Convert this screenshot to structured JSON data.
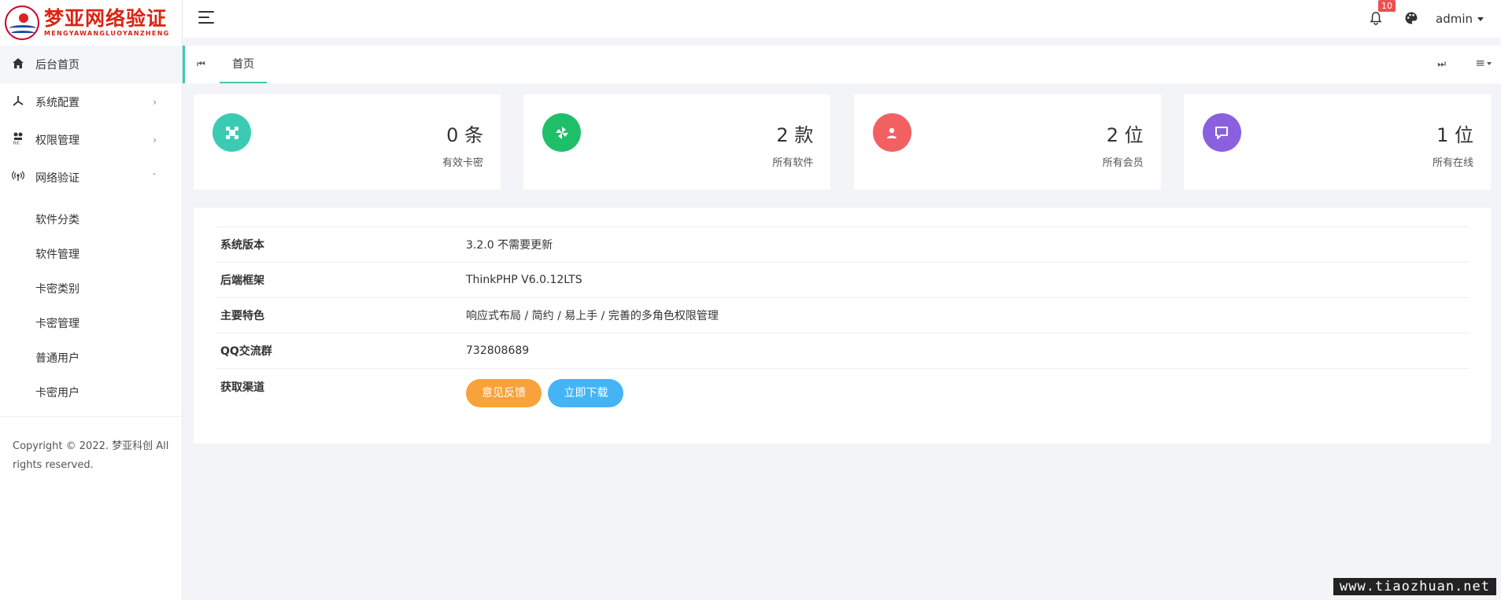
{
  "logo": {
    "cn": "梦亚网络验证",
    "en": "MENGYAWANGLUOYANZHENG"
  },
  "sidebar": {
    "items": [
      {
        "label": "后台首页",
        "icon": "home-icon"
      },
      {
        "label": "系统配置",
        "icon": "config-icon"
      },
      {
        "label": "权限管理",
        "icon": "permission-icon"
      },
      {
        "label": "网络验证",
        "icon": "network-icon"
      }
    ],
    "sub_items": [
      "软件分类",
      "软件管理",
      "卡密类别",
      "卡密管理",
      "普通用户",
      "卡密用户"
    ],
    "copyright": "Copyright © 2022. 梦亚科创 All rights reserved."
  },
  "topbar": {
    "notification_count": "10",
    "user": "admin"
  },
  "tabs": {
    "home": "首页"
  },
  "stats": [
    {
      "value": "0 条",
      "label": "有效卡密",
      "color": "#3bcbb4",
      "icon": "card-icon"
    },
    {
      "value": "2 款",
      "label": "所有软件",
      "color": "#1fbf69",
      "icon": "pinwheel-icon"
    },
    {
      "value": "2 位",
      "label": "所有会员",
      "color": "#f26161",
      "icon": "user-icon"
    },
    {
      "value": "1 位",
      "label": "所有在线",
      "color": "#8b60df",
      "icon": "chat-icon"
    }
  ],
  "info": [
    {
      "key": "系统版本",
      "value": "3.2.0 不需要更新"
    },
    {
      "key": "后端框架",
      "value": "ThinkPHP V6.0.12LTS"
    },
    {
      "key": "主要特色",
      "value": "响应式布局 / 简约 / 易上手 / 完善的多角色权限管理"
    },
    {
      "key": "QQ交流群",
      "value": "732808689"
    },
    {
      "key": "获取渠道",
      "value": ""
    }
  ],
  "buttons": {
    "feedback": "意见反馈",
    "download": "立即下载"
  },
  "watermark": "www.tiaozhuan.net"
}
